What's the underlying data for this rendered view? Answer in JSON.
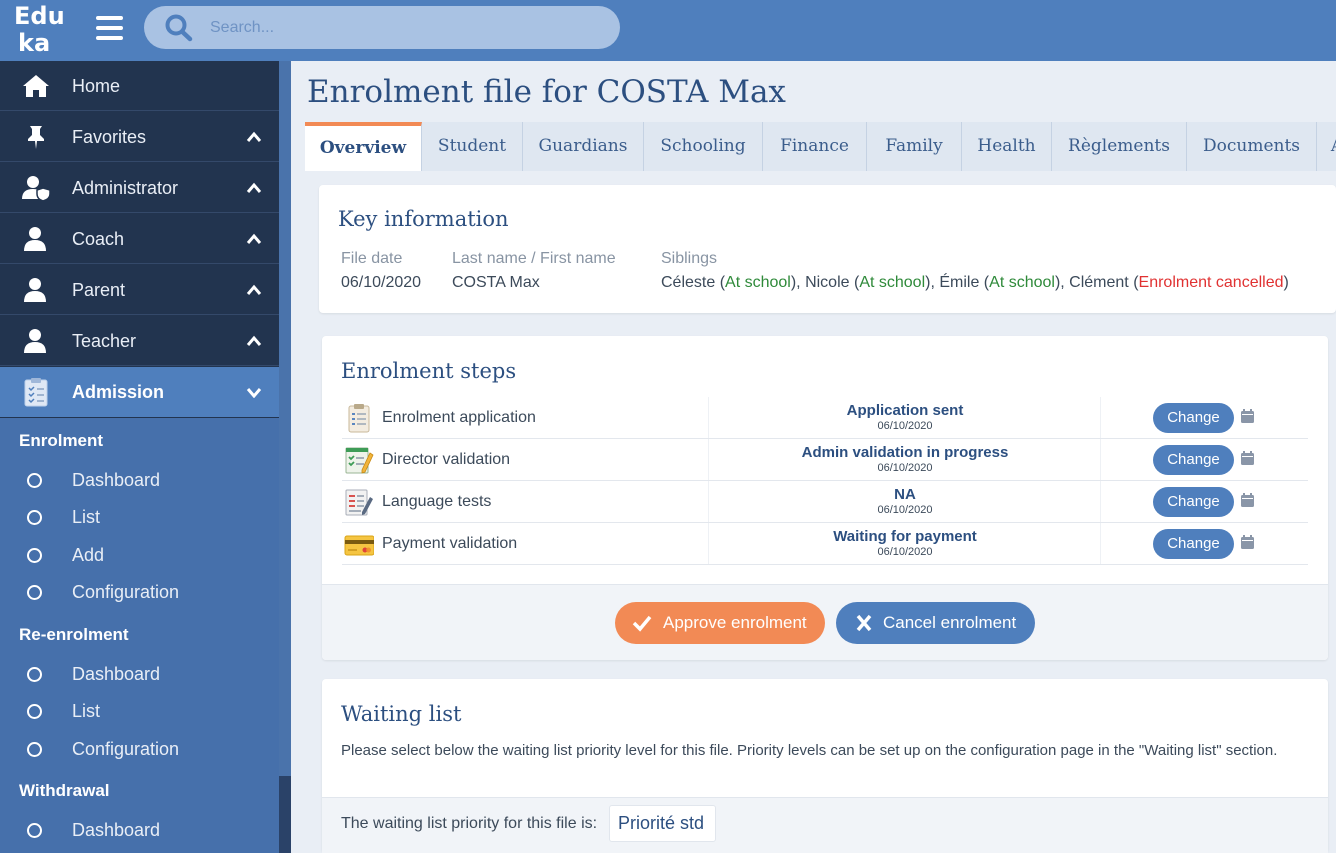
{
  "app": {
    "logo_line1": "Edu",
    "logo_line2": "ka",
    "search_placeholder": "Search...",
    "accent_color": "#4f7fbd",
    "sidebar_color": "#22344f",
    "approve_color": "#f28a55"
  },
  "sidebar": {
    "items": [
      {
        "label": "Home",
        "icon": "home-icon"
      },
      {
        "label": "Favorites",
        "icon": "pin-icon"
      },
      {
        "label": "Administrator",
        "icon": "user-shield-icon"
      },
      {
        "label": "Coach",
        "icon": "user-icon"
      },
      {
        "label": "Parent",
        "icon": "user-icon"
      },
      {
        "label": "Teacher",
        "icon": "user-icon"
      },
      {
        "label": "Admission",
        "icon": "clipboard-icon"
      }
    ],
    "sections": [
      {
        "title": "Enrolment",
        "items": [
          "Dashboard",
          "List",
          "Add",
          "Configuration"
        ]
      },
      {
        "title": "Re-enrolment",
        "items": [
          "Dashboard",
          "List",
          "Configuration"
        ]
      },
      {
        "title": "Withdrawal",
        "items": [
          "Dashboard"
        ]
      }
    ]
  },
  "main": {
    "title": "Enrolment file for COSTA Max",
    "tabs": [
      "Overview",
      "Student",
      "Guardians",
      "Schooling",
      "Finance",
      "Family",
      "Health",
      "Règlements",
      "Documents",
      "A"
    ],
    "active_tab": "Overview",
    "key_info": {
      "title": "Key information",
      "file_date_label": "File date",
      "file_date": "06/10/2020",
      "name_label": "Last name / First name",
      "name": "COSTA Max",
      "siblings_label": "Siblings",
      "siblings": [
        {
          "name": "Céleste",
          "status": "At school",
          "sep": ", "
        },
        {
          "name": "Nicole",
          "status": "At school",
          "sep": ", "
        },
        {
          "name": "Émile",
          "status": "At school",
          "sep": ", "
        },
        {
          "name": "Clément",
          "status": "Enrolment cancelled",
          "sep": ""
        }
      ]
    },
    "steps": {
      "title": "Enrolment steps",
      "rows": [
        {
          "name": "Enrolment application",
          "icon": "clipboard-checklist-icon",
          "status": "Application sent",
          "date": "06/10/2020",
          "button": "Change"
        },
        {
          "name": "Director validation",
          "icon": "checklist-pencil-icon",
          "status": "Admin validation in progress",
          "date": "06/10/2020",
          "button": "Change"
        },
        {
          "name": "Language tests",
          "icon": "test-paper-icon",
          "status": "NA",
          "date": "06/10/2020",
          "button": "Change"
        },
        {
          "name": "Payment validation",
          "icon": "credit-card-icon",
          "status": "Waiting for payment",
          "date": "06/10/2020",
          "button": "Change"
        }
      ],
      "approve_label": "Approve enrolment",
      "cancel_label": "Cancel enrolment"
    },
    "waiting_list": {
      "title": "Waiting list",
      "description": "Please select below the waiting list priority level for this file. Priority levels can be set up on the configuration page in the \"Waiting list\" section.",
      "priority_label": "The waiting list priority for this file is:",
      "priority_value": "Priorité std"
    }
  }
}
